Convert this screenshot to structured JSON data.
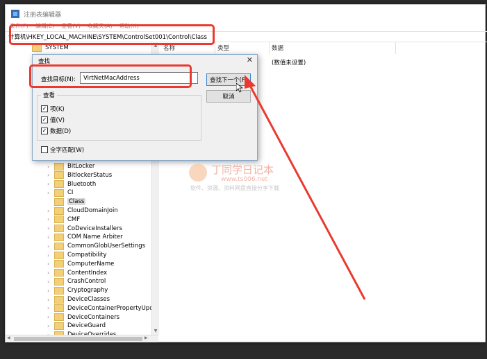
{
  "window": {
    "title": "注册表编辑器",
    "menu": [
      "文件(F)",
      "编辑(E)",
      "查看(V)",
      "收藏夹(A)",
      "帮助(H)"
    ],
    "address": "计算机\\HKEY_LOCAL_MACHINE\\SYSTEM\\ControlSet001\\Control\\Class"
  },
  "tree": {
    "top_item": "SYSTEM",
    "items": [
      "BitLocker",
      "BitlockerStatus",
      "Bluetooth",
      "CI",
      "Class",
      "CloudDomainJoin",
      "CMF",
      "CoDeviceInstallers",
      "COM Name Arbiter",
      "CommonGlobUserSettings",
      "Compatibility",
      "ComputerName",
      "ContentIndex",
      "CrashControl",
      "Cryptography",
      "DeviceClasses",
      "DeviceContainerPropertyUpdate",
      "DeviceContainers",
      "DeviceGuard",
      "DeviceOverrides"
    ],
    "selected": "Class"
  },
  "list": {
    "columns": [
      "名称",
      "类型",
      "数据"
    ],
    "row_value_data": "(数值未设置)"
  },
  "find_dialog": {
    "title": "查找",
    "target_label": "查找目标(N):",
    "target_value": "VirtNetMacAddress",
    "find_next_label": "查找下一个(F)",
    "cancel_label": "取消",
    "look_at_label": "查看",
    "options": [
      {
        "label": "项(K)",
        "checked": true
      },
      {
        "label": "值(V)",
        "checked": true
      },
      {
        "label": "数据(D)",
        "checked": true
      }
    ],
    "match_whole": {
      "label": "全字匹配(W)",
      "checked": false
    }
  },
  "watermark": {
    "title": "丁同学日记本",
    "url": "www.ts006.net",
    "subtitle": "软件、资源、资料网盘直接分享下载"
  },
  "colors": {
    "highlight": "#ea3a2f",
    "folder": "#f3d078"
  }
}
